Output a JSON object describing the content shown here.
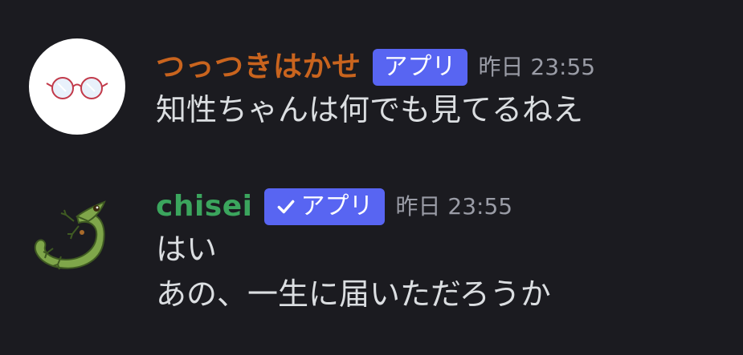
{
  "messages": [
    {
      "username": "つっつきはかせ",
      "username_color": "#c9641e",
      "avatar_icon": "round-glasses-icon",
      "badge": {
        "label": "アプリ",
        "verified": false,
        "color": "#5865f2"
      },
      "timestamp": "昨日 23:55",
      "lines": [
        "知性ちゃんは何でも見てるねえ"
      ]
    },
    {
      "username": "chisei",
      "username_color": "#3ba55d",
      "avatar_icon": "green-lizard-icon",
      "badge": {
        "label": "アプリ",
        "verified": true,
        "color": "#5865f2"
      },
      "timestamp": "昨日 23:55",
      "lines": [
        "はい",
        "あの、一生に届いただろうか"
      ]
    }
  ]
}
